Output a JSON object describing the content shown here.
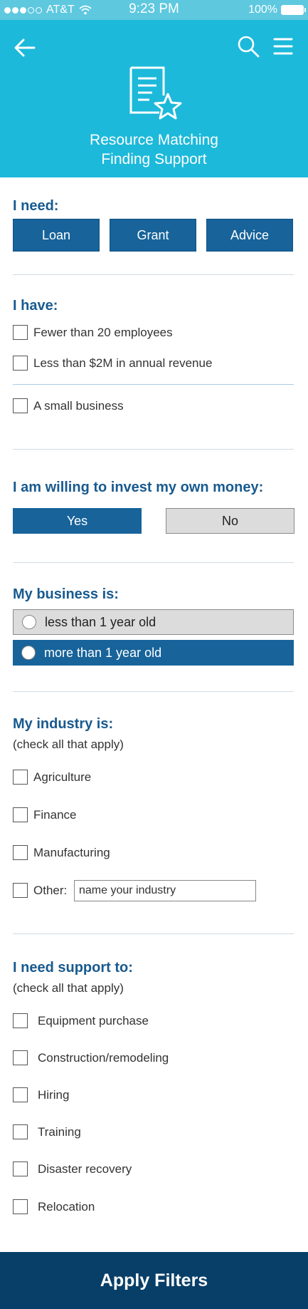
{
  "status": {
    "carrier": "AT&T",
    "time": "9:23 PM",
    "battery": "100%"
  },
  "header": {
    "title_line1": "Resource Matching",
    "title_line2": "Finding Support"
  },
  "need": {
    "title": "I need:",
    "buttons": [
      "Loan",
      "Grant",
      "Advice"
    ]
  },
  "have": {
    "title": "I have:",
    "items": [
      "Fewer than 20 employees",
      "Less than $2M in annual revenue",
      "A small business"
    ]
  },
  "invest": {
    "title": "I am willing to invest my own money:",
    "yes": "Yes",
    "no": "No"
  },
  "business": {
    "title": "My business is:",
    "options": [
      "less than 1 year old",
      "more than 1 year old"
    ]
  },
  "industry": {
    "title": "My industry is:",
    "subtitle": "(check all that apply)",
    "items": [
      "Agriculture",
      "Finance",
      "Manufacturing"
    ],
    "other_label": "Other:",
    "other_value": "name your industry"
  },
  "support": {
    "title": "I need support to:",
    "subtitle": "(check all that apply)",
    "items": [
      "Equipment purchase",
      "Construction/remodeling",
      "Hiring",
      "Training",
      "Disaster recovery",
      "Relocation"
    ]
  },
  "apply_label": "Apply Filters",
  "colors": {
    "header_bg": "#1cb9da",
    "accent": "#17639a",
    "title": "#185a8f",
    "apply_bg": "#083f68"
  },
  "icons": [
    "back-arrow-icon",
    "search-icon",
    "menu-icon",
    "document-star-icon",
    "wifi-icon",
    "battery-icon"
  ]
}
